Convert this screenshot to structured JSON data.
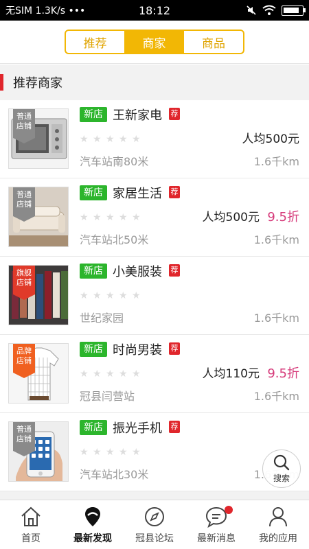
{
  "status_bar": {
    "carrier": "无SIM",
    "speed": "1.3K/s",
    "dots": "•••",
    "time": "18:12"
  },
  "segment": {
    "tabs": [
      "推荐",
      "商家",
      "商品"
    ],
    "active_index": 1
  },
  "section": {
    "title": "推荐商家"
  },
  "items": [
    {
      "tag": "普通店铺",
      "tag_color": "gray",
      "new": "新店",
      "name": "王新家电",
      "rec": "荐",
      "price": "人均500元",
      "discount": "",
      "location": "汽车站南80米",
      "distance": "1.6千km",
      "image": "microwave"
    },
    {
      "tag": "普通店铺",
      "tag_color": "gray",
      "new": "新店",
      "name": "家居生活",
      "rec": "荐",
      "price": "人均500元",
      "discount": "9.5折",
      "location": "汽车站北50米",
      "distance": "1.6千km",
      "image": "sofa"
    },
    {
      "tag": "旗舰店铺",
      "tag_color": "red",
      "new": "新店",
      "name": "小美服装",
      "rec": "荐",
      "price": "",
      "discount": "",
      "location": "世纪家园",
      "distance": "1.6千km",
      "image": "clothes"
    },
    {
      "tag": "品牌店铺",
      "tag_color": "orange",
      "new": "新店",
      "name": "时尚男装",
      "rec": "荐",
      "price": "人均110元",
      "discount": "9.5折",
      "location": "冠县闫营站",
      "distance": "1.6千km",
      "image": "shirt"
    },
    {
      "tag": "普通店铺",
      "tag_color": "gray",
      "new": "新店",
      "name": "振光手机",
      "rec": "荐",
      "price": "",
      "discount": "",
      "location": "汽车站北30米",
      "distance": "1.6千km",
      "image": "phone"
    }
  ],
  "search_fab": {
    "label": "搜索"
  },
  "tabbar": {
    "tabs": [
      {
        "label": "首页",
        "icon": "home-icon"
      },
      {
        "label": "最新发现",
        "icon": "location-pin-icon"
      },
      {
        "label": "冠县论坛",
        "icon": "compass-icon"
      },
      {
        "label": "最新消息",
        "icon": "chat-bubble-icon"
      },
      {
        "label": "我的应用",
        "icon": "user-icon"
      }
    ],
    "active_index": 1
  },
  "colors": {
    "accent": "#f2b705",
    "new_badge": "#2cb52c",
    "rec_badge": "#e0262c",
    "discount": "#d63a7a"
  }
}
